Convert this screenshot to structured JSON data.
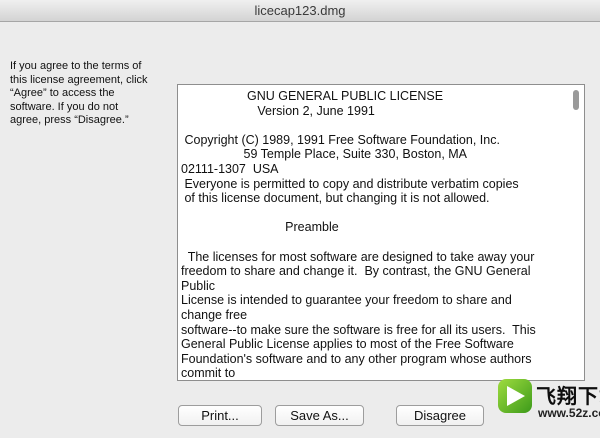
{
  "window": {
    "title": "licecap123.dmg"
  },
  "instructions": {
    "lines": [
      "If you agree to the terms of",
      "this license agreement, click",
      "“Agree” to access the",
      "software.  If you do not",
      "agree, press “Disagree.”"
    ]
  },
  "license": {
    "lines": [
      "                   GNU GENERAL PUBLIC LICENSE",
      "                      Version 2, June 1991",
      "",
      " Copyright (C) 1989, 1991 Free Software Foundation, Inc.",
      "                  59 Temple Place, Suite 330, Boston, MA",
      "02111-1307  USA",
      " Everyone is permitted to copy and distribute verbatim copies",
      " of this license document, but changing it is not allowed.",
      "",
      "                              Preamble",
      "",
      "  The licenses for most software are designed to take away your",
      "freedom to share and change it.  By contrast, the GNU General",
      "Public",
      "License is intended to guarantee your freedom to share and",
      "change free",
      "software--to make sure the software is free for all its users.  This",
      "General Public License applies to most of the Free Software",
      "Foundation's software and to any other program whose authors",
      "commit to"
    ]
  },
  "buttons": {
    "print": "Print...",
    "save_as": "Save As...",
    "disagree": "Disagree"
  },
  "watermark": {
    "name": "飞翔下载",
    "url": "www.52z.com"
  }
}
